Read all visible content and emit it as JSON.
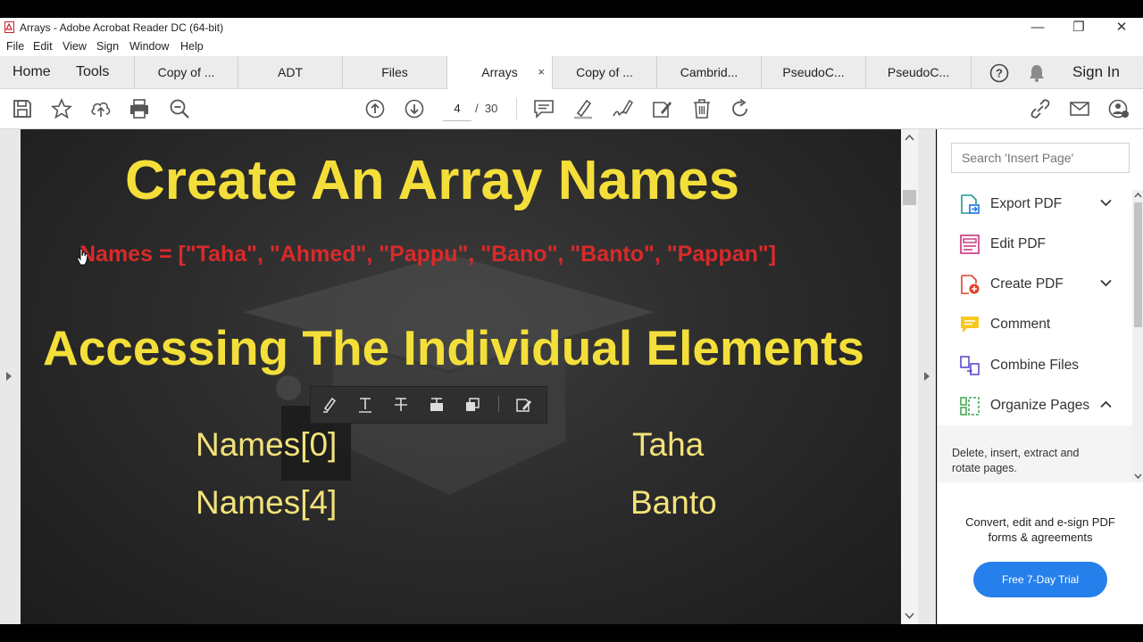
{
  "window": {
    "title": "Arrays - Adobe Acrobat Reader DC (64-bit)"
  },
  "menu": [
    "File",
    "Edit",
    "View",
    "Sign",
    "Window",
    "Help"
  ],
  "nav": {
    "home": "Home",
    "tools": "Tools",
    "sign_in": "Sign In"
  },
  "tabs": [
    {
      "label": "Copy of ..."
    },
    {
      "label": "ADT"
    },
    {
      "label": "Files"
    },
    {
      "label": "Arrays",
      "close": "×"
    },
    {
      "label": "Copy of ..."
    },
    {
      "label": "Cambrid..."
    },
    {
      "label": "PseudoC..."
    },
    {
      "label": "PseudoC..."
    }
  ],
  "toolbar": {
    "current_page": "4",
    "page_sep": "/",
    "total_pages": "30"
  },
  "slide": {
    "title": "Create An Array Names",
    "code": "Names =  [\"Taha\", \"Ahmed\", \"Pappu\", \"Bano\", \"Banto\", \"Pappan\"]",
    "heading": "Accessing The Individual Elements",
    "rows": [
      {
        "expr": "Names[0]",
        "value": "Taha"
      },
      {
        "expr": "Names[4]",
        "value": "Banto"
      }
    ],
    "colors": {
      "title": "#f4df3a",
      "code": "#d92a2a",
      "text": "#f2e27a"
    }
  },
  "right_panel": {
    "search_placeholder": "Search 'Insert Page'",
    "tools": [
      {
        "label": "Export PDF",
        "icon": "export-pdf-icon",
        "chevron": "down"
      },
      {
        "label": "Edit PDF",
        "icon": "edit-pdf-icon"
      },
      {
        "label": "Create PDF",
        "icon": "create-pdf-icon",
        "chevron": "down"
      },
      {
        "label": "Comment",
        "icon": "comment-icon"
      },
      {
        "label": "Combine Files",
        "icon": "combine-files-icon"
      },
      {
        "label": "Organize Pages",
        "icon": "organize-pages-icon",
        "chevron": "up"
      }
    ],
    "organize_desc": "Delete, insert, extract and rotate pages.",
    "promo": "Convert, edit and e-sign PDF forms & agreements",
    "trial_button": "Free 7-Day Trial",
    "trial_color": "#2680eb"
  }
}
